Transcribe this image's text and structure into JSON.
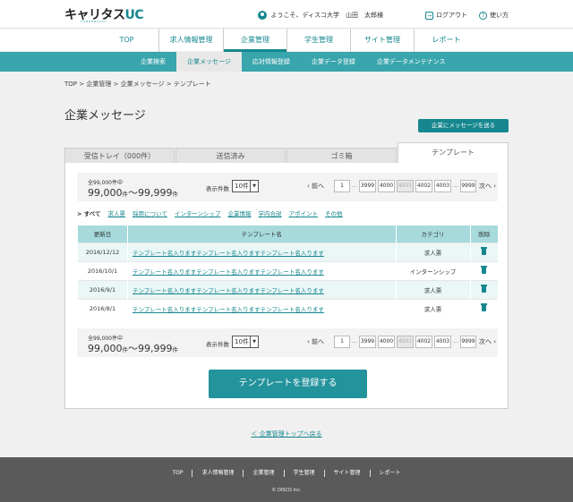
{
  "header": {
    "logo_main": "キャリタス",
    "logo_accent": "UC",
    "logo_sub": "CAREERTASU",
    "welcome": "ようこそ、ディスコ大学　山田　太郎様",
    "logout": "ログアウト",
    "help": "使い方"
  },
  "main_nav": [
    "TOP",
    "求人情報管理",
    "企業管理",
    "学生管理",
    "サイト管理",
    "レポート"
  ],
  "sub_nav": [
    "企業検索",
    "企業メッセージ",
    "応対情報登録",
    "企業データ登録",
    "企業データメンテナンス"
  ],
  "breadcrumb": "TOP > 企業管理 > 企業メッセージ > テンプレート",
  "page_title": "企業メッセージ",
  "send_button": "企業にメッセージを送る",
  "tabs": [
    "受信トレイ（000件）",
    "送信済み",
    "ゴミ箱",
    "テンプレート"
  ],
  "pager": {
    "total_label": "全99,000件中",
    "range_from": "99,000",
    "range_to": "99,999",
    "unit": "件",
    "range_sep": "～",
    "per_page_label": "表示件数",
    "per_page_value": "10件",
    "prev": "前へ",
    "next": "次へ",
    "first_page": "1",
    "dots": "…",
    "pages": [
      "3999",
      "4000",
      "4001",
      "4002",
      "4003"
    ],
    "last_page": "9999",
    "current_page": "4001"
  },
  "filters": {
    "current": "すべて",
    "links": [
      "求人票",
      "採用について",
      "インターンシップ",
      "企業情報",
      "学内合説",
      "アポイント",
      "その他"
    ]
  },
  "table": {
    "headers": [
      "更新日",
      "テンプレート名",
      "カテゴリ",
      "削除"
    ],
    "rows": [
      {
        "date": "2016/12/12",
        "name": "テンプレート名入りますテンプレート名入りますテンプレート名入ります",
        "category": "求人票"
      },
      {
        "date": "2016/10/1",
        "name": "テンプレート名入りますテンプレート名入りますテンプレート名入ります",
        "category": "インターンシップ"
      },
      {
        "date": "2016/9/1",
        "name": "テンプレート名入りますテンプレート名入りますテンプレート名入ります",
        "category": "求人票"
      },
      {
        "date": "2016/8/1",
        "name": "テンプレート名入りますテンプレート名入りますテンプレート名入ります",
        "category": "求人票"
      }
    ]
  },
  "register_button": "テンプレートを登録する",
  "back_link": "＜ 企業管理トップへ戻る",
  "footer": {
    "links": [
      "TOP",
      "求人情報管理",
      "企業管理",
      "学生管理",
      "サイト管理",
      "レポート"
    ],
    "copyright": "© DISCO Inc."
  },
  "colors": {
    "accent": "#16878f",
    "subnav": "#39a5ad",
    "table_header": "#a6dadd",
    "row_alt": "#ebf7f7",
    "footer": "#5a5a5a"
  }
}
